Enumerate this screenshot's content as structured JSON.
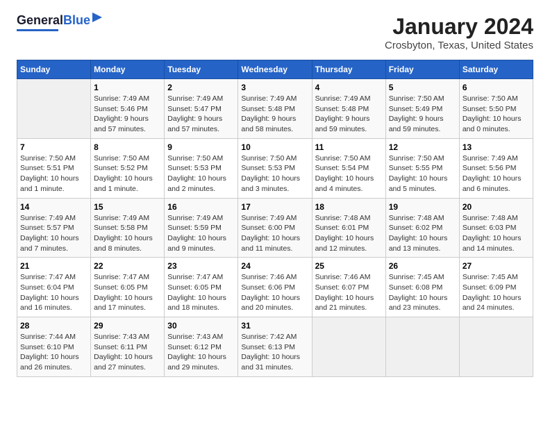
{
  "logo": {
    "line1": "General",
    "line2": "Blue"
  },
  "title": "January 2024",
  "subtitle": "Crosbyton, Texas, United States",
  "weekdays": [
    "Sunday",
    "Monday",
    "Tuesday",
    "Wednesday",
    "Thursday",
    "Friday",
    "Saturday"
  ],
  "weeks": [
    [
      {
        "num": "",
        "info": ""
      },
      {
        "num": "1",
        "info": "Sunrise: 7:49 AM\nSunset: 5:46 PM\nDaylight: 9 hours\nand 57 minutes."
      },
      {
        "num": "2",
        "info": "Sunrise: 7:49 AM\nSunset: 5:47 PM\nDaylight: 9 hours\nand 57 minutes."
      },
      {
        "num": "3",
        "info": "Sunrise: 7:49 AM\nSunset: 5:48 PM\nDaylight: 9 hours\nand 58 minutes."
      },
      {
        "num": "4",
        "info": "Sunrise: 7:49 AM\nSunset: 5:48 PM\nDaylight: 9 hours\nand 59 minutes."
      },
      {
        "num": "5",
        "info": "Sunrise: 7:50 AM\nSunset: 5:49 PM\nDaylight: 9 hours\nand 59 minutes."
      },
      {
        "num": "6",
        "info": "Sunrise: 7:50 AM\nSunset: 5:50 PM\nDaylight: 10 hours\nand 0 minutes."
      }
    ],
    [
      {
        "num": "7",
        "info": "Sunrise: 7:50 AM\nSunset: 5:51 PM\nDaylight: 10 hours\nand 1 minute."
      },
      {
        "num": "8",
        "info": "Sunrise: 7:50 AM\nSunset: 5:52 PM\nDaylight: 10 hours\nand 1 minute."
      },
      {
        "num": "9",
        "info": "Sunrise: 7:50 AM\nSunset: 5:53 PM\nDaylight: 10 hours\nand 2 minutes."
      },
      {
        "num": "10",
        "info": "Sunrise: 7:50 AM\nSunset: 5:53 PM\nDaylight: 10 hours\nand 3 minutes."
      },
      {
        "num": "11",
        "info": "Sunrise: 7:50 AM\nSunset: 5:54 PM\nDaylight: 10 hours\nand 4 minutes."
      },
      {
        "num": "12",
        "info": "Sunrise: 7:50 AM\nSunset: 5:55 PM\nDaylight: 10 hours\nand 5 minutes."
      },
      {
        "num": "13",
        "info": "Sunrise: 7:49 AM\nSunset: 5:56 PM\nDaylight: 10 hours\nand 6 minutes."
      }
    ],
    [
      {
        "num": "14",
        "info": "Sunrise: 7:49 AM\nSunset: 5:57 PM\nDaylight: 10 hours\nand 7 minutes."
      },
      {
        "num": "15",
        "info": "Sunrise: 7:49 AM\nSunset: 5:58 PM\nDaylight: 10 hours\nand 8 minutes."
      },
      {
        "num": "16",
        "info": "Sunrise: 7:49 AM\nSunset: 5:59 PM\nDaylight: 10 hours\nand 9 minutes."
      },
      {
        "num": "17",
        "info": "Sunrise: 7:49 AM\nSunset: 6:00 PM\nDaylight: 10 hours\nand 11 minutes."
      },
      {
        "num": "18",
        "info": "Sunrise: 7:48 AM\nSunset: 6:01 PM\nDaylight: 10 hours\nand 12 minutes."
      },
      {
        "num": "19",
        "info": "Sunrise: 7:48 AM\nSunset: 6:02 PM\nDaylight: 10 hours\nand 13 minutes."
      },
      {
        "num": "20",
        "info": "Sunrise: 7:48 AM\nSunset: 6:03 PM\nDaylight: 10 hours\nand 14 minutes."
      }
    ],
    [
      {
        "num": "21",
        "info": "Sunrise: 7:47 AM\nSunset: 6:04 PM\nDaylight: 10 hours\nand 16 minutes."
      },
      {
        "num": "22",
        "info": "Sunrise: 7:47 AM\nSunset: 6:05 PM\nDaylight: 10 hours\nand 17 minutes."
      },
      {
        "num": "23",
        "info": "Sunrise: 7:47 AM\nSunset: 6:05 PM\nDaylight: 10 hours\nand 18 minutes."
      },
      {
        "num": "24",
        "info": "Sunrise: 7:46 AM\nSunset: 6:06 PM\nDaylight: 10 hours\nand 20 minutes."
      },
      {
        "num": "25",
        "info": "Sunrise: 7:46 AM\nSunset: 6:07 PM\nDaylight: 10 hours\nand 21 minutes."
      },
      {
        "num": "26",
        "info": "Sunrise: 7:45 AM\nSunset: 6:08 PM\nDaylight: 10 hours\nand 23 minutes."
      },
      {
        "num": "27",
        "info": "Sunrise: 7:45 AM\nSunset: 6:09 PM\nDaylight: 10 hours\nand 24 minutes."
      }
    ],
    [
      {
        "num": "28",
        "info": "Sunrise: 7:44 AM\nSunset: 6:10 PM\nDaylight: 10 hours\nand 26 minutes."
      },
      {
        "num": "29",
        "info": "Sunrise: 7:43 AM\nSunset: 6:11 PM\nDaylight: 10 hours\nand 27 minutes."
      },
      {
        "num": "30",
        "info": "Sunrise: 7:43 AM\nSunset: 6:12 PM\nDaylight: 10 hours\nand 29 minutes."
      },
      {
        "num": "31",
        "info": "Sunrise: 7:42 AM\nSunset: 6:13 PM\nDaylight: 10 hours\nand 31 minutes."
      },
      {
        "num": "",
        "info": ""
      },
      {
        "num": "",
        "info": ""
      },
      {
        "num": "",
        "info": ""
      }
    ]
  ]
}
